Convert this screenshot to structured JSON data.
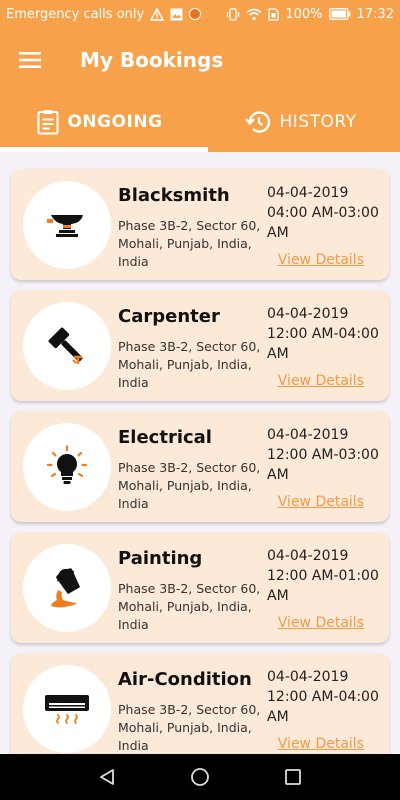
{
  "status_bar": {
    "carrier_text": "Emergency calls only",
    "battery_percent": "100%",
    "time": "17:32"
  },
  "app_bar": {
    "title": "My Bookings"
  },
  "tabs": [
    {
      "label": "ONGOING",
      "icon": "clipboard-icon",
      "active": true
    },
    {
      "label": "HISTORY",
      "icon": "history-icon",
      "active": false
    }
  ],
  "bookings": [
    {
      "service": "Blacksmith",
      "address": "Phase 3B-2, Sector 60, Mohali, Punjab, India, India",
      "date": "04-04-2019 04:00 AM-03:00 AM",
      "link": "View Details",
      "icon": "anvil-icon"
    },
    {
      "service": "Carpenter",
      "address": "Phase 3B-2, Sector 60, Mohali, Punjab, India, India",
      "date": "04-04-2019 12:00 AM-04:00 AM",
      "link": "View Details",
      "icon": "hammer-icon"
    },
    {
      "service": "Electrical",
      "address": "Phase 3B-2, Sector 60, Mohali, Punjab, India, India",
      "date": "04-04-2019 12:00 AM-03:00 AM",
      "link": "View Details",
      "icon": "lightbulb-icon"
    },
    {
      "service": "Painting",
      "address": "Phase 3B-2, Sector 60, Mohali, Punjab, India, India",
      "date": "04-04-2019 12:00 AM-01:00 AM",
      "link": "View Details",
      "icon": "paint-bucket-icon"
    },
    {
      "service": "Air-Condition",
      "address": "Phase 3B-2, Sector 60, Mohali, Punjab, India, India",
      "date": "04-04-2019 12:00 AM-04:00 AM",
      "link": "View Details",
      "icon": "air-conditioner-icon"
    }
  ],
  "colors": {
    "primary": "#f7a14a",
    "card_bg": "#fde9d7",
    "link": "#f39a47",
    "icon_accent": "#f07d1e"
  }
}
